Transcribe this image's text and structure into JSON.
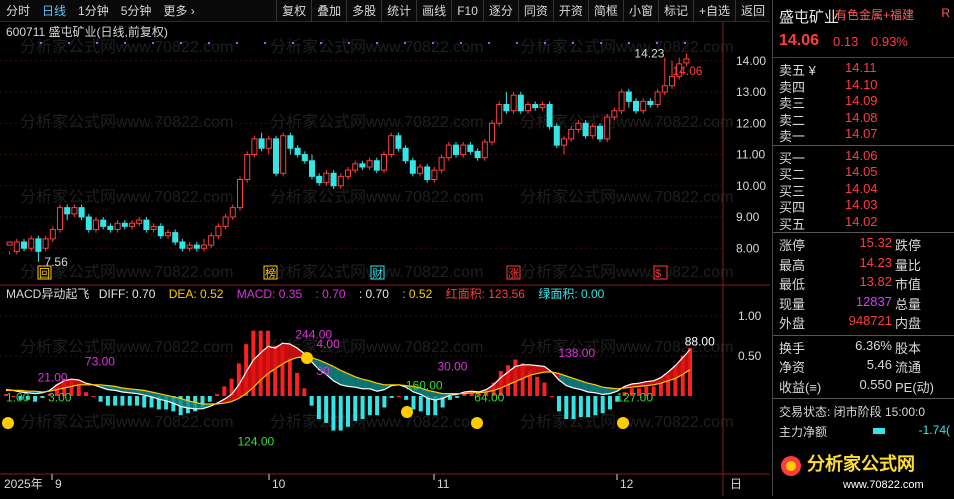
{
  "toolbar": {
    "items": [
      "分时",
      "日线",
      "1分钟",
      "5分钟",
      "更多 ›"
    ],
    "buttons": [
      "复权",
      "叠加",
      "多股",
      "统计",
      "画线",
      "F10",
      "逐分",
      "同资",
      "开资",
      "简框",
      "小窗",
      "标记",
      "+自选",
      "返回"
    ]
  },
  "chart_header": "600711  盛屯矿业(日线,前复权)",
  "stock": {
    "name": "盛屯矿业",
    "industry": "有色金属+福建",
    "badge": "R",
    "price": "14.06",
    "change": "0.13",
    "pct": "0.93%"
  },
  "asks": [
    {
      "label": "卖五 ¥",
      "price": "14.11"
    },
    {
      "label": "卖四",
      "price": "14.10"
    },
    {
      "label": "卖三",
      "price": "14.09"
    },
    {
      "label": "卖二",
      "price": "14.08"
    },
    {
      "label": "卖一",
      "price": "14.07"
    }
  ],
  "bids": [
    {
      "label": "买一",
      "price": "14.06"
    },
    {
      "label": "买二",
      "price": "14.05"
    },
    {
      "label": "买三",
      "price": "14.04"
    },
    {
      "label": "买四",
      "price": "14.03"
    },
    {
      "label": "买五",
      "price": "14.02"
    }
  ],
  "stats": [
    {
      "l": "涨停",
      "v": "15.32",
      "c": "#ff3d3d",
      "r": "跌停"
    },
    {
      "l": "最高",
      "v": "14.23",
      "c": "#ff3d3d",
      "r": "量比"
    },
    {
      "l": "最低",
      "v": "13.82",
      "c": "#ff3d3d",
      "r": "市值"
    },
    {
      "l": "现量",
      "v": "12837",
      "c": "#cc44ff",
      "r": "总量"
    },
    {
      "l": "外盘",
      "v": "948721",
      "c": "#ff3d3d",
      "r": "内盘"
    }
  ],
  "stats2": [
    {
      "l": "换手",
      "v": "6.36%",
      "c": "#d8d8d8",
      "r": "股本"
    },
    {
      "l": "净资",
      "v": "5.46",
      "c": "#d8d8d8",
      "r": "流通"
    },
    {
      "l": "收益(≡)",
      "v": "0.550",
      "c": "#d8d8d8",
      "r": "PE(动)"
    }
  ],
  "trade_status": "交易状态: 闭市阶段 15:00:0",
  "main_net": {
    "label": "主力净额",
    "value": "-1.74("
  },
  "logo": {
    "text": "分析家公式网",
    "url": "www.70822.com"
  },
  "watermark": "分析家公式网www.70822.com",
  "indicator_header": {
    "name": "MACD异动起飞",
    "diff": "DIFF: 0.70",
    "dea": "DEA: 0.52",
    "macd": "MACD: 0.35",
    "v1": ": 0.70",
    "v2": ": 0.70",
    "v3": ": 0.52",
    "red_area": "红面积: 123.56",
    "green_area": "绿面积: 0.00"
  },
  "chart_data": {
    "type": "candlestick",
    "price_axis": [
      "14.00",
      "13.00",
      "12.00",
      "11.00",
      "10.00",
      "9.00",
      "8.00"
    ],
    "price_range": [
      7.4,
      14.6
    ],
    "macd_axis": [
      "1.00",
      "0.50"
    ],
    "macd_range": [
      -0.95,
      1.15
    ],
    "x_labels": [
      "2025年",
      "9",
      "10",
      "11",
      "12",
      "日"
    ],
    "low_label": "7.56",
    "high_label": "14.23",
    "last_label": "14.06",
    "event_labels": [
      "回",
      "榜",
      "财",
      "涨",
      "$"
    ],
    "candles": [
      [
        8.1,
        8.2,
        7.9,
        7.8
      ],
      [
        7.9,
        8.2,
        8.3,
        7.8
      ],
      [
        8.2,
        8.0,
        8.3,
        7.9
      ],
      [
        8.0,
        8.3,
        8.4,
        7.9
      ],
      [
        8.3,
        7.9,
        8.4,
        7.56
      ],
      [
        8.0,
        8.3,
        8.4,
        7.9
      ],
      [
        8.3,
        8.6,
        8.7,
        8.2
      ],
      [
        8.6,
        9.3,
        9.4,
        8.5
      ],
      [
        9.3,
        9.1,
        9.4,
        8.9
      ],
      [
        9.1,
        9.3,
        9.4,
        9.0
      ],
      [
        9.3,
        9.0,
        9.4,
        8.9
      ],
      [
        9.0,
        8.6,
        9.1,
        8.5
      ],
      [
        8.6,
        8.9,
        9.0,
        8.5
      ],
      [
        8.9,
        8.7,
        9.0,
        8.6
      ],
      [
        8.7,
        8.6,
        8.8,
        8.5
      ],
      [
        8.6,
        8.8,
        8.9,
        8.5
      ],
      [
        8.8,
        8.7,
        8.9,
        8.6
      ],
      [
        8.7,
        8.8,
        8.9,
        8.6
      ],
      [
        8.8,
        8.9,
        9.0,
        8.7
      ],
      [
        8.9,
        8.6,
        9.0,
        8.5
      ],
      [
        8.6,
        8.7,
        8.8,
        8.5
      ],
      [
        8.7,
        8.4,
        8.8,
        8.3
      ],
      [
        8.4,
        8.5,
        8.6,
        8.3
      ],
      [
        8.5,
        8.2,
        8.6,
        8.1
      ],
      [
        8.2,
        8.0,
        8.3,
        7.9
      ],
      [
        8.0,
        8.1,
        8.2,
        7.9
      ],
      [
        8.1,
        8.0,
        8.2,
        7.9
      ],
      [
        8.0,
        8.1,
        8.3,
        7.9
      ],
      [
        8.1,
        8.4,
        8.5,
        8.0
      ],
      [
        8.4,
        8.7,
        8.8,
        8.3
      ],
      [
        8.7,
        9.0,
        9.1,
        8.6
      ],
      [
        9.0,
        9.3,
        9.4,
        8.9
      ],
      [
        9.3,
        10.2,
        10.3,
        9.2
      ],
      [
        10.2,
        11.0,
        11.1,
        10.1
      ],
      [
        11.0,
        11.5,
        11.6,
        10.9
      ],
      [
        11.5,
        11.2,
        11.7,
        11.1
      ],
      [
        11.2,
        11.5,
        11.6,
        11.0
      ],
      [
        11.5,
        10.4,
        11.6,
        10.3
      ],
      [
        10.4,
        11.6,
        11.7,
        10.3
      ],
      [
        11.6,
        11.2,
        11.7,
        11.0
      ],
      [
        11.2,
        11.0,
        11.3,
        10.9
      ],
      [
        11.0,
        10.8,
        11.1,
        10.7
      ],
      [
        10.8,
        10.3,
        11.0,
        10.2
      ],
      [
        10.3,
        10.1,
        10.4,
        10.0
      ],
      [
        10.1,
        10.4,
        10.5,
        10.0
      ],
      [
        10.4,
        10.0,
        10.5,
        9.9
      ],
      [
        10.0,
        10.3,
        10.4,
        9.9
      ],
      [
        10.3,
        10.5,
        10.6,
        10.2
      ],
      [
        10.5,
        10.7,
        10.8,
        10.4
      ],
      [
        10.7,
        10.6,
        10.8,
        10.5
      ],
      [
        10.6,
        10.8,
        10.9,
        10.5
      ],
      [
        10.8,
        10.5,
        10.9,
        10.4
      ],
      [
        10.5,
        11.0,
        11.1,
        10.4
      ],
      [
        11.0,
        11.6,
        11.7,
        10.9
      ],
      [
        11.6,
        11.2,
        11.7,
        11.1
      ],
      [
        11.2,
        10.8,
        11.3,
        10.7
      ],
      [
        10.8,
        10.4,
        10.9,
        10.3
      ],
      [
        10.4,
        10.6,
        10.7,
        10.3
      ],
      [
        10.6,
        10.2,
        10.7,
        10.1
      ],
      [
        10.2,
        10.5,
        10.6,
        10.1
      ],
      [
        10.5,
        10.9,
        11.0,
        10.4
      ],
      [
        10.9,
        11.3,
        11.4,
        10.8
      ],
      [
        11.3,
        11.0,
        11.4,
        10.9
      ],
      [
        11.0,
        11.3,
        11.4,
        10.9
      ],
      [
        11.3,
        11.1,
        11.4,
        11.0
      ],
      [
        11.1,
        10.9,
        11.2,
        10.8
      ],
      [
        10.9,
        11.4,
        11.5,
        10.8
      ],
      [
        11.4,
        12.0,
        12.1,
        11.3
      ],
      [
        12.0,
        12.6,
        12.7,
        11.9
      ],
      [
        12.6,
        12.4,
        13.0,
        12.3
      ],
      [
        12.4,
        12.9,
        13.0,
        12.3
      ],
      [
        12.9,
        12.4,
        13.0,
        12.3
      ],
      [
        12.4,
        12.6,
        12.7,
        12.3
      ],
      [
        12.6,
        12.5,
        12.7,
        12.4
      ],
      [
        12.5,
        12.6,
        12.7,
        12.4
      ],
      [
        12.6,
        11.9,
        12.7,
        11.8
      ],
      [
        11.9,
        11.3,
        12.0,
        11.2
      ],
      [
        11.3,
        11.5,
        11.6,
        11.0
      ],
      [
        11.5,
        11.8,
        11.9,
        11.4
      ],
      [
        11.8,
        12.0,
        12.1,
        11.7
      ],
      [
        12.0,
        11.6,
        12.1,
        11.5
      ],
      [
        11.6,
        11.9,
        12.0,
        11.5
      ],
      [
        11.9,
        11.5,
        12.0,
        11.4
      ],
      [
        11.5,
        12.2,
        12.3,
        11.4
      ],
      [
        12.2,
        12.4,
        12.5,
        12.1
      ],
      [
        12.4,
        13.0,
        13.1,
        12.3
      ],
      [
        13.0,
        12.7,
        13.1,
        12.5
      ],
      [
        12.7,
        12.4,
        12.8,
        12.3
      ],
      [
        12.4,
        12.7,
        12.8,
        12.3
      ],
      [
        12.7,
        12.6,
        12.8,
        12.5
      ],
      [
        12.6,
        13.0,
        13.1,
        12.5
      ],
      [
        13.0,
        13.2,
        14.1,
        12.9
      ],
      [
        13.2,
        13.5,
        14.0,
        13.1
      ],
      [
        13.5,
        13.9,
        14.1,
        13.4
      ],
      [
        13.93,
        14.06,
        14.23,
        13.82
      ]
    ],
    "macd": {
      "diff": [
        0.08,
        0.07,
        0.05,
        0.04,
        0.03,
        0.04,
        0.07,
        0.14,
        0.19,
        0.21,
        0.2,
        0.16,
        0.14,
        0.11,
        0.08,
        0.07,
        0.05,
        0.04,
        0.03,
        0.01,
        -0.01,
        -0.04,
        -0.06,
        -0.09,
        -0.13,
        -0.15,
        -0.16,
        -0.16,
        -0.13,
        -0.09,
        -0.04,
        0.02,
        0.14,
        0.3,
        0.45,
        0.54,
        0.62,
        0.6,
        0.66,
        0.65,
        0.6,
        0.53,
        0.43,
        0.33,
        0.27,
        0.19,
        0.14,
        0.12,
        0.11,
        0.09,
        0.09,
        0.06,
        0.08,
        0.13,
        0.14,
        0.11,
        0.05,
        0.02,
        -0.03,
        -0.05,
        -0.03,
        0.01,
        0.02,
        0.05,
        0.06,
        0.05,
        0.08,
        0.14,
        0.23,
        0.3,
        0.37,
        0.39,
        0.39,
        0.38,
        0.37,
        0.3,
        0.2,
        0.13,
        0.1,
        0.08,
        0.05,
        0.04,
        0.02,
        0.03,
        0.06,
        0.12,
        0.15,
        0.16,
        0.18,
        0.19,
        0.23,
        0.3,
        0.38,
        0.48,
        0.58
      ],
      "dea": [
        0.07,
        0.07,
        0.07,
        0.06,
        0.06,
        0.05,
        0.06,
        0.08,
        0.1,
        0.12,
        0.14,
        0.14,
        0.14,
        0.14,
        0.13,
        0.12,
        0.1,
        0.09,
        0.08,
        0.07,
        0.05,
        0.03,
        0.01,
        -0.01,
        -0.03,
        -0.06,
        -0.08,
        -0.1,
        -0.1,
        -0.1,
        -0.09,
        -0.07,
        -0.03,
        0.03,
        0.11,
        0.2,
        0.28,
        0.34,
        0.4,
        0.45,
        0.48,
        0.49,
        0.48,
        0.45,
        0.41,
        0.37,
        0.32,
        0.28,
        0.24,
        0.21,
        0.19,
        0.16,
        0.14,
        0.14,
        0.14,
        0.13,
        0.12,
        0.1,
        0.07,
        0.05,
        0.03,
        0.03,
        0.03,
        0.03,
        0.04,
        0.04,
        0.05,
        0.07,
        0.1,
        0.14,
        0.18,
        0.22,
        0.26,
        0.28,
        0.3,
        0.3,
        0.28,
        0.25,
        0.22,
        0.19,
        0.16,
        0.14,
        0.11,
        0.1,
        0.09,
        0.1,
        0.11,
        0.12,
        0.13,
        0.14,
        0.16,
        0.19,
        0.22,
        0.27,
        0.33
      ]
    },
    "macd_annotations": [
      {
        "t": "1.00",
        "i": 0,
        "v": -0.07,
        "c": "#33dd33"
      },
      {
        "t": "3.00",
        "i": 8,
        "v": -0.07,
        "c": "#33dd33"
      },
      {
        "t": "21.00",
        "i": 6,
        "v": 0.18,
        "c": "#dd33dd"
      },
      {
        "t": "73.00",
        "i": 15,
        "v": 0.38,
        "c": "#dd33dd"
      },
      {
        "t": "124.00",
        "i": 44,
        "v": -0.62,
        "c": "#33dd33"
      },
      {
        "t": "244.00",
        "i": 55,
        "v": 0.72,
        "c": "#dd33dd"
      },
      {
        "t": "4.00",
        "i": 59,
        "v": 0.6,
        "c": "#dd33dd"
      },
      {
        "t": "30",
        "i": 59,
        "v": 0.26,
        "c": "#dd33dd"
      },
      {
        "t": "160.00",
        "i": 76,
        "v": 0.08,
        "c": "#33dd33"
      },
      {
        "t": "30.00",
        "i": 82,
        "v": 0.32,
        "c": "#dd33dd"
      },
      {
        "t": "64.00",
        "i": 89,
        "v": -0.07,
        "c": "#33dd33"
      },
      {
        "t": "138.00",
        "i": 105,
        "v": 0.49,
        "c": "#dd33dd"
      },
      {
        "t": "127.00",
        "i": 116,
        "v": -0.07,
        "c": "#33dd33"
      },
      {
        "t": "88.00",
        "i": 129,
        "v": 0.63,
        "c": "#ffffff"
      }
    ]
  }
}
